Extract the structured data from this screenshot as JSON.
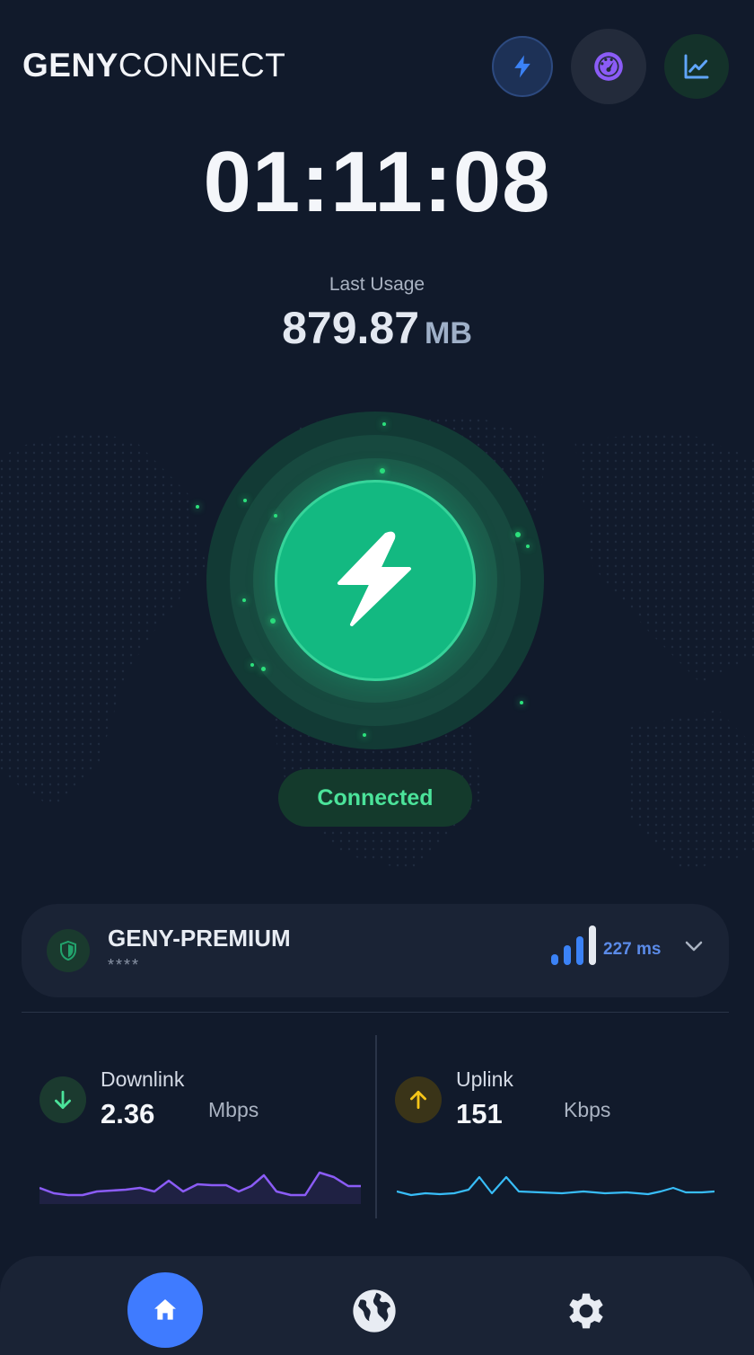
{
  "app": {
    "brand_bold": "GENY",
    "brand_light": "CONNECT"
  },
  "header": {
    "buttons": [
      {
        "icon": "lightning-icon",
        "color": "#3b82f6"
      },
      {
        "icon": "speedometer-icon",
        "color": "#8b5cf6"
      },
      {
        "icon": "chart-line-icon",
        "color": "#60a5fa"
      }
    ]
  },
  "session": {
    "timer": "01:11:08",
    "usage_label": "Last Usage",
    "usage_value": "879.87",
    "usage_unit": "MB"
  },
  "connection": {
    "status": "Connected",
    "accent": "#13b981"
  },
  "server": {
    "name": "GENY-PREMIUM",
    "sub": "****",
    "ping": "227 ms",
    "signal_bars_active": 3,
    "signal_bars_total": 4
  },
  "stats": {
    "downlink": {
      "label": "Downlink",
      "value": "2.36",
      "unit": "Mbps",
      "color": "#8b5cf6"
    },
    "uplink": {
      "label": "Uplink",
      "value": "151",
      "unit": "Kbps",
      "color": "#38bdf8"
    }
  },
  "nav": {
    "items": [
      {
        "icon": "home-icon",
        "active": true
      },
      {
        "icon": "globe-icon",
        "active": false
      },
      {
        "icon": "gear-icon",
        "active": false
      }
    ]
  }
}
